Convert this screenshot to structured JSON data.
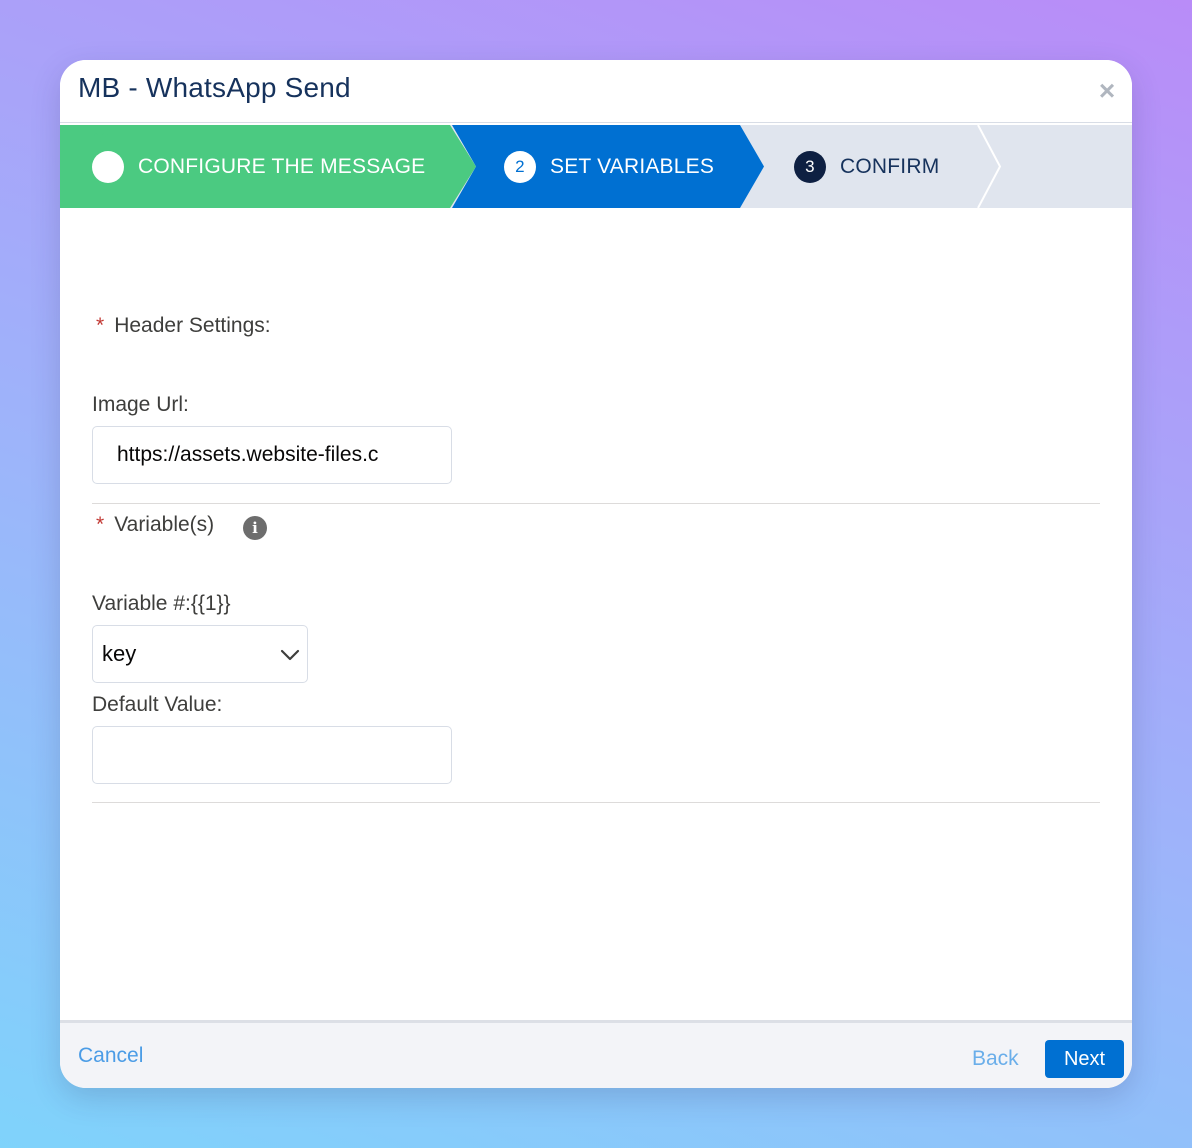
{
  "modal": {
    "title": "MB - WhatsApp Send",
    "close_symbol": "×"
  },
  "steps": [
    {
      "label": "CONFIGURE THE MESSAGE",
      "state": "complete",
      "badge_icon": "check-icon"
    },
    {
      "label": "SET VARIABLES",
      "state": "current",
      "badge": "2"
    },
    {
      "label": "CONFIRM",
      "state": "upcoming",
      "badge": "3"
    }
  ],
  "header_settings": {
    "required_mark": "*",
    "label": "Header Settings:",
    "image_url_label": "Image Url:",
    "image_url_value": "https://assets.website-files.c"
  },
  "variables": {
    "required_mark": "*",
    "label": "Variable(s)",
    "info_icon": "info-icon",
    "info_symbol": "i",
    "items": [
      {
        "label": "Variable #:{{1}}",
        "selected": "key",
        "default_value_label": "Default Value:",
        "default_value": ""
      }
    ]
  },
  "footer": {
    "cancel_label": "Cancel",
    "back_label": "Back",
    "next_label": "Next"
  },
  "colors": {
    "complete": "#4bca81",
    "current": "#0070d2",
    "upcoming": "#e0e5ee",
    "title": "#16325c",
    "link": "#4b9ce6"
  }
}
